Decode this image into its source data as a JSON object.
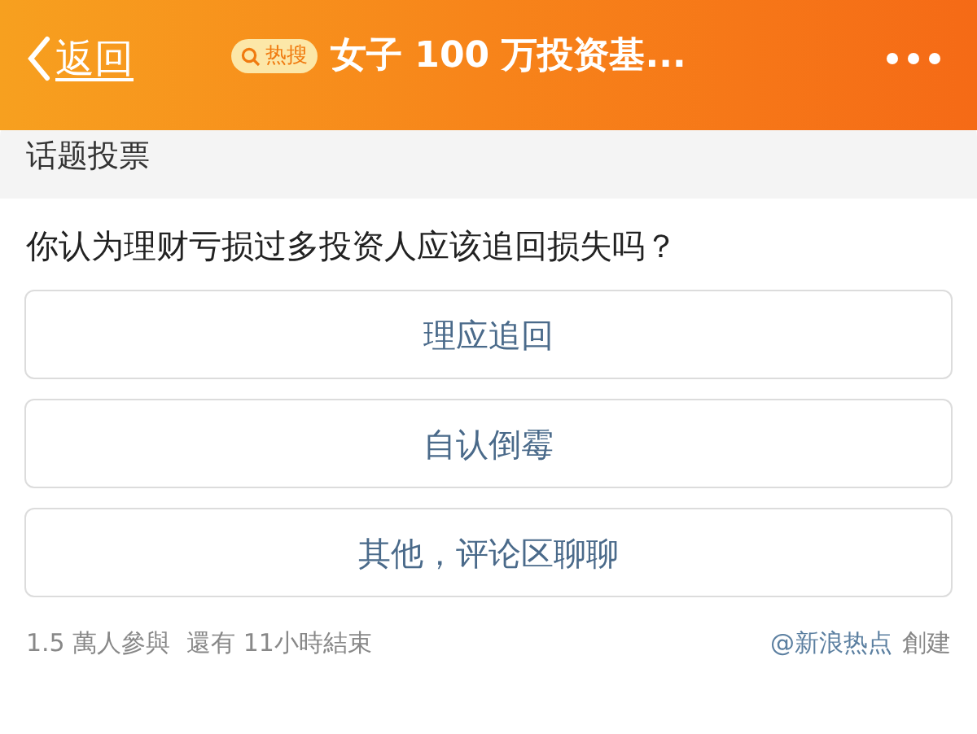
{
  "header": {
    "back_label": "返回",
    "badge": "热搜",
    "title": "女子 100 万投资基..."
  },
  "section_title": "话题投票",
  "poll": {
    "question": "你认为理财亏损过多投资人应该追回损失吗？",
    "options": [
      {
        "label": "理应追回"
      },
      {
        "label": "自认倒霉"
      },
      {
        "label": "其他，评论区聊聊"
      }
    ],
    "participants": "1.5 萬人參與",
    "time_left": "還有 11小時結束",
    "creator": "@新浪热点",
    "creator_suffix": "創建"
  }
}
